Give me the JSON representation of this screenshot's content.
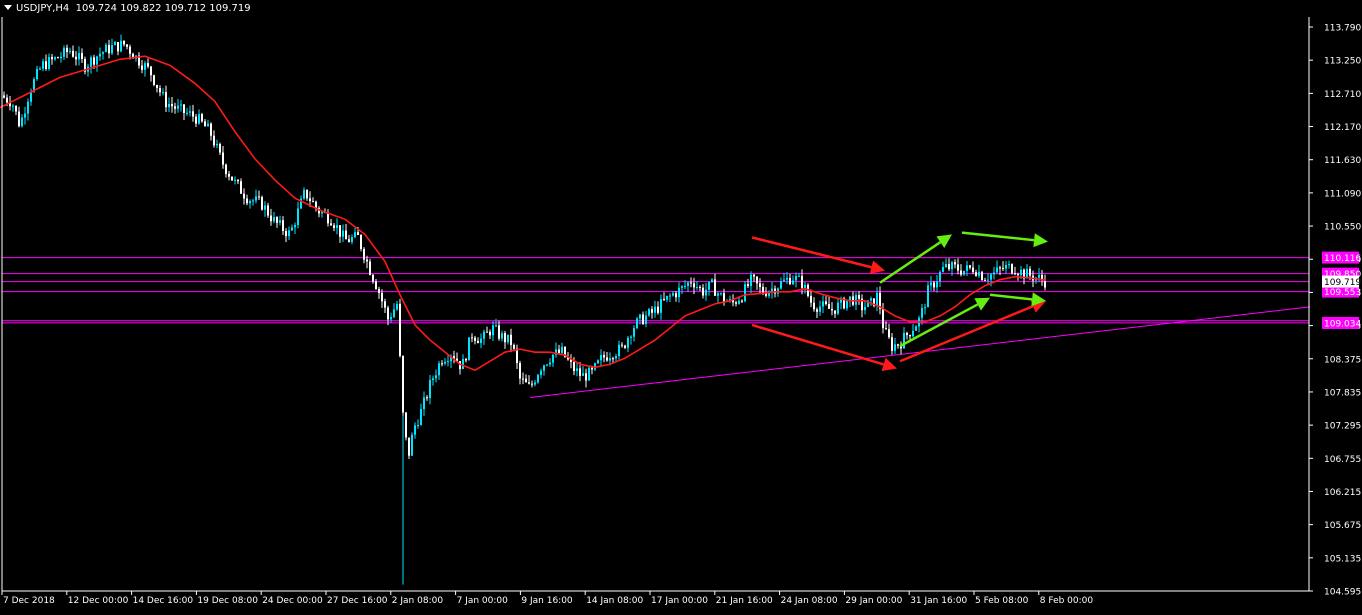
{
  "header": {
    "symbol": "USDJPY,H4",
    "ohlc": "109.724 109.822 109.712 109.719"
  },
  "colors": {
    "background": "#000000",
    "axis": "#ffffff",
    "bull_candle": "#00e5ff",
    "bear_candle": "#ffffff",
    "moving_average": "#ff1a1a",
    "horizontal_lines": "#ff00ff",
    "trend_line": "#ff00ff",
    "arrow_red": "#ff1a1a",
    "arrow_green": "#66ee11"
  },
  "chart_data": {
    "type": "candlestick",
    "symbol": "USDJPY",
    "timeframe": "H4",
    "ylim": [
      104.595,
      114.1
    ],
    "y_ticks": [
      "113.790",
      "113.250",
      "112.710",
      "112.170",
      "111.630",
      "111.090",
      "110.550",
      "109.995",
      "109.455",
      "108.915",
      "108.375",
      "107.835",
      "107.295",
      "106.755",
      "106.215",
      "105.675",
      "105.135",
      "104.595"
    ],
    "x_ticks": [
      "7 Dec 2018",
      "12 Dec 00:00",
      "14 Dec 16:00",
      "19 Dec 08:00",
      "24 Dec 00:00",
      "27 Dec 16:00",
      "2 Jan 08:00",
      "7 Jan 00:00",
      "9 Jan 16:00",
      "14 Jan 08:00",
      "17 Jan 00:00",
      "21 Jan 16:00",
      "24 Jan 08:00",
      "29 Jan 00:00",
      "31 Jan 16:00",
      "5 Feb 08:00",
      "8 Feb 00:00"
    ],
    "price_path": [
      [
        0,
        112.8
      ],
      [
        12,
        112.7
      ],
      [
        20,
        112.3
      ],
      [
        30,
        112.9
      ],
      [
        42,
        113.3
      ],
      [
        55,
        113.4
      ],
      [
        70,
        113.55
      ],
      [
        85,
        113.3
      ],
      [
        100,
        113.5
      ],
      [
        112,
        113.6
      ],
      [
        125,
        113.65
      ],
      [
        135,
        113.45
      ],
      [
        150,
        113.2
      ],
      [
        165,
        112.7
      ],
      [
        180,
        112.55
      ],
      [
        195,
        112.45
      ],
      [
        210,
        112.2
      ],
      [
        222,
        111.7
      ],
      [
        235,
        111.35
      ],
      [
        248,
        111.1
      ],
      [
        262,
        111.0
      ],
      [
        275,
        110.7
      ],
      [
        290,
        110.5
      ],
      [
        305,
        111.2
      ],
      [
        318,
        110.9
      ],
      [
        332,
        110.75
      ],
      [
        345,
        110.4
      ],
      [
        358,
        110.45
      ],
      [
        368,
        110.0
      ],
      [
        378,
        109.6
      ],
      [
        388,
        109.1
      ],
      [
        397,
        109.35
      ],
      [
        403,
        107.5
      ],
      [
        408,
        106.8
      ],
      [
        414,
        107.3
      ],
      [
        422,
        107.6
      ],
      [
        432,
        108.1
      ],
      [
        442,
        108.45
      ],
      [
        452,
        108.55
      ],
      [
        462,
        108.3
      ],
      [
        472,
        108.85
      ],
      [
        482,
        108.75
      ],
      [
        492,
        108.95
      ],
      [
        502,
        108.8
      ],
      [
        512,
        108.7
      ],
      [
        520,
        108.1
      ],
      [
        530,
        107.95
      ],
      [
        540,
        108.3
      ],
      [
        552,
        108.5
      ],
      [
        562,
        108.55
      ],
      [
        572,
        108.3
      ],
      [
        582,
        108.15
      ],
      [
        592,
        108.2
      ],
      [
        602,
        108.45
      ],
      [
        612,
        108.55
      ],
      [
        622,
        108.6
      ],
      [
        632,
        108.95
      ],
      [
        642,
        109.1
      ],
      [
        652,
        109.2
      ],
      [
        662,
        109.35
      ],
      [
        672,
        109.5
      ],
      [
        682,
        109.6
      ],
      [
        692,
        109.75
      ],
      [
        702,
        109.55
      ],
      [
        712,
        109.65
      ],
      [
        722,
        109.45
      ],
      [
        732,
        109.35
      ],
      [
        742,
        109.5
      ],
      [
        752,
        109.75
      ],
      [
        762,
        109.55
      ],
      [
        772,
        109.6
      ],
      [
        782,
        109.7
      ],
      [
        792,
        109.8
      ],
      [
        802,
        109.7
      ],
      [
        812,
        109.35
      ],
      [
        822,
        109.3
      ],
      [
        832,
        109.25
      ],
      [
        842,
        109.35
      ],
      [
        852,
        109.45
      ],
      [
        862,
        109.3
      ],
      [
        872,
        109.35
      ],
      [
        878,
        109.5
      ],
      [
        884,
        108.9
      ],
      [
        892,
        108.65
      ],
      [
        900,
        108.7
      ],
      [
        910,
        108.9
      ],
      [
        920,
        109.1
      ],
      [
        928,
        109.55
      ],
      [
        936,
        109.75
      ],
      [
        944,
        109.95
      ],
      [
        954,
        109.95
      ],
      [
        964,
        109.9
      ],
      [
        974,
        109.95
      ],
      [
        984,
        109.8
      ],
      [
        994,
        109.85
      ],
      [
        1004,
        109.95
      ],
      [
        1014,
        109.95
      ],
      [
        1024,
        109.85
      ],
      [
        1034,
        109.8
      ],
      [
        1046,
        109.72
      ]
    ],
    "moving_average_path": [
      [
        0,
        112.6
      ],
      [
        30,
        112.85
      ],
      [
        60,
        113.1
      ],
      [
        90,
        113.25
      ],
      [
        120,
        113.4
      ],
      [
        145,
        113.45
      ],
      [
        170,
        113.3
      ],
      [
        195,
        113.0
      ],
      [
        215,
        112.7
      ],
      [
        235,
        112.2
      ],
      [
        255,
        111.75
      ],
      [
        275,
        111.4
      ],
      [
        295,
        111.1
      ],
      [
        320,
        110.9
      ],
      [
        345,
        110.75
      ],
      [
        365,
        110.5
      ],
      [
        385,
        110.05
      ],
      [
        400,
        109.5
      ],
      [
        415,
        109.0
      ],
      [
        430,
        108.75
      ],
      [
        445,
        108.55
      ],
      [
        460,
        108.35
      ],
      [
        475,
        108.25
      ],
      [
        490,
        108.4
      ],
      [
        505,
        108.55
      ],
      [
        520,
        108.6
      ],
      [
        535,
        108.55
      ],
      [
        550,
        108.55
      ],
      [
        565,
        108.5
      ],
      [
        580,
        108.35
      ],
      [
        595,
        108.3
      ],
      [
        610,
        108.35
      ],
      [
        625,
        108.45
      ],
      [
        640,
        108.6
      ],
      [
        655,
        108.75
      ],
      [
        670,
        108.95
      ],
      [
        685,
        109.15
      ],
      [
        700,
        109.25
      ],
      [
        715,
        109.35
      ],
      [
        730,
        109.4
      ],
      [
        745,
        109.5
      ],
      [
        760,
        109.52
      ],
      [
        775,
        109.55
      ],
      [
        790,
        109.55
      ],
      [
        805,
        109.6
      ],
      [
        820,
        109.52
      ],
      [
        835,
        109.45
      ],
      [
        850,
        109.4
      ],
      [
        865,
        109.4
      ],
      [
        880,
        109.3
      ],
      [
        895,
        109.15
      ],
      [
        910,
        109.05
      ],
      [
        925,
        109.05
      ],
      [
        940,
        109.15
      ],
      [
        955,
        109.3
      ],
      [
        970,
        109.5
      ],
      [
        985,
        109.65
      ],
      [
        1000,
        109.75
      ],
      [
        1015,
        109.8
      ],
      [
        1030,
        109.78
      ],
      [
        1046,
        109.74
      ]
    ],
    "low_spike": {
      "x": 403,
      "low": 104.7
    },
    "horizontal_levels": [
      {
        "price": 110.116,
        "label": "110.116"
      },
      {
        "price": 109.85,
        "label": "109.850"
      },
      {
        "price": 109.719,
        "label": "109.719"
      },
      {
        "price": 109.553,
        "label": "109.553"
      },
      {
        "price": 109.07,
        "label": ""
      },
      {
        "price": 109.034,
        "label": "109.034"
      }
    ],
    "current_price": {
      "price": 109.719,
      "label": "109.719"
    },
    "trend_line": {
      "from": {
        "x": 530,
        "price": 107.8
      },
      "to": {
        "x": 1310,
        "price": 109.3
      }
    },
    "arrows": [
      {
        "color": "red",
        "from": {
          "x": 752,
          "price": 110.45
        },
        "to": {
          "x": 885,
          "price": 109.9
        }
      },
      {
        "color": "red",
        "from": {
          "x": 752,
          "price": 109.0
        },
        "to": {
          "x": 897,
          "price": 108.28
        }
      },
      {
        "color": "red",
        "from": {
          "x": 900,
          "price": 108.4
        },
        "to": {
          "x": 1046,
          "price": 109.4
        }
      },
      {
        "color": "green",
        "from": {
          "x": 880,
          "price": 109.7
        },
        "to": {
          "x": 952,
          "price": 110.5
        }
      },
      {
        "color": "green",
        "from": {
          "x": 962,
          "price": 110.53
        },
        "to": {
          "x": 1048,
          "price": 110.38
        }
      },
      {
        "color": "green",
        "from": {
          "x": 900,
          "price": 108.65
        },
        "to": {
          "x": 990,
          "price": 109.45
        }
      },
      {
        "color": "green",
        "from": {
          "x": 990,
          "price": 109.5
        },
        "to": {
          "x": 1046,
          "price": 109.4
        }
      }
    ]
  }
}
